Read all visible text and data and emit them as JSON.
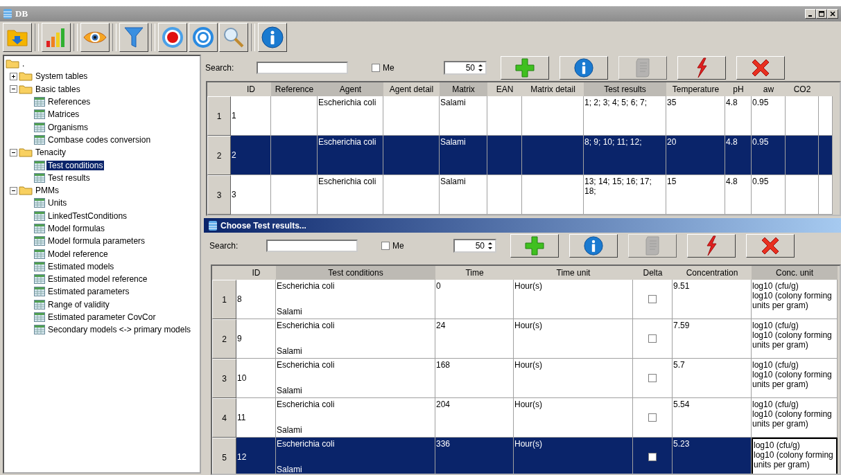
{
  "window": {
    "title": "DB"
  },
  "toolbar": [
    {
      "kind": "folder"
    },
    {
      "kind": "chart"
    },
    {
      "kind": "eye"
    },
    {
      "kind": "filter"
    },
    {
      "kind": "record"
    },
    {
      "kind": "ring"
    },
    {
      "kind": "search"
    },
    {
      "kind": "info"
    }
  ],
  "tree": {
    "label": ".",
    "children": [
      {
        "label": "System tables",
        "kind": "folder",
        "expanded": false,
        "selected": false
      },
      {
        "label": "Basic tables",
        "kind": "folder",
        "expanded": true,
        "selected": false,
        "children": [
          {
            "label": "References",
            "kind": "table",
            "selected": false
          },
          {
            "label": "Matrices",
            "kind": "table",
            "selected": false
          },
          {
            "label": "Organisms",
            "kind": "table",
            "selected": false
          },
          {
            "label": "Combase codes conversion",
            "kind": "table",
            "selected": false
          }
        ]
      },
      {
        "label": "Tenacity",
        "kind": "folder",
        "expanded": true,
        "selected": false,
        "children": [
          {
            "label": "Test conditions",
            "kind": "table",
            "selected": true
          },
          {
            "label": "Test results",
            "kind": "table",
            "selected": false
          }
        ]
      },
      {
        "label": "PMMs",
        "kind": "folder",
        "expanded": true,
        "selected": false,
        "children": [
          {
            "label": "Units",
            "kind": "table",
            "selected": false
          },
          {
            "label": "LinkedTestConditions",
            "kind": "table",
            "selected": false
          },
          {
            "label": "Model formulas",
            "kind": "table",
            "selected": false
          },
          {
            "label": "Model formula parameters",
            "kind": "table",
            "selected": false
          },
          {
            "label": "Model reference",
            "kind": "table",
            "selected": false
          },
          {
            "label": "Estimated models",
            "kind": "table",
            "selected": false
          },
          {
            "label": "Estimated model reference",
            "kind": "table",
            "selected": false
          },
          {
            "label": "Estimated parameters",
            "kind": "table",
            "selected": false
          },
          {
            "label": "Range of validity",
            "kind": "table",
            "selected": false
          },
          {
            "label": "Estimated parameter CovCor",
            "kind": "table",
            "selected": false
          },
          {
            "label": "Secondary models <-> primary models",
            "kind": "table",
            "selected": false
          }
        ]
      }
    ]
  },
  "main": {
    "search_label": "Search:",
    "me": {
      "label": "Me",
      "checked": false
    },
    "page_size": "50",
    "actions": [
      {
        "kind": "add",
        "disabled": false
      },
      {
        "kind": "info",
        "disabled": false
      },
      {
        "kind": "script",
        "disabled": true
      },
      {
        "kind": "lightning",
        "disabled": false
      },
      {
        "kind": "delete",
        "disabled": false
      }
    ],
    "table": {
      "columns": [
        {
          "label": "ID",
          "shaded": false
        },
        {
          "label": "Reference",
          "shaded": true
        },
        {
          "label": "Agent",
          "shaded": true
        },
        {
          "label": "Agent detail",
          "shaded": false
        },
        {
          "label": "Matrix",
          "shaded": true
        },
        {
          "label": "EAN",
          "shaded": false
        },
        {
          "label": "Matrix detail",
          "shaded": false
        },
        {
          "label": "Test results",
          "shaded": true
        },
        {
          "label": "Temperature",
          "shaded": false
        },
        {
          "label": "pH",
          "shaded": false
        },
        {
          "label": "aw",
          "shaded": false
        },
        {
          "label": "CO2",
          "shaded": false
        }
      ],
      "rows": [
        {
          "number": "1",
          "selected": false,
          "cells": [
            "1",
            null,
            "Escherichia coli",
            null,
            "Salami",
            null,
            null,
            "1; 2; 3; 4; 5; 6; 7;",
            "35",
            "4.8",
            "0.95",
            null
          ]
        },
        {
          "number": "2",
          "selected": true,
          "cells": [
            "2",
            null,
            "Escherichia coli",
            null,
            "Salami",
            null,
            null,
            "8; 9; 10; 11; 12;",
            "20",
            "4.8",
            "0.95",
            null
          ]
        },
        {
          "number": "3",
          "selected": false,
          "cells": [
            "3",
            null,
            "Escherichia coli",
            null,
            "Salami",
            null,
            null,
            "13; 14; 15; 16; 17; 18;",
            "15",
            "4.8",
            "0.95",
            null
          ]
        }
      ]
    }
  },
  "dialog": {
    "title": "Choose Test results...",
    "search_label": "Search:",
    "me": {
      "label": "Me",
      "checked": false
    },
    "page_size": "50",
    "actions": [
      {
        "kind": "add",
        "disabled": false
      },
      {
        "kind": "info",
        "disabled": false
      },
      {
        "kind": "script",
        "disabled": true
      },
      {
        "kind": "lightning",
        "disabled": false
      },
      {
        "kind": "delete",
        "disabled": false
      }
    ],
    "table": {
      "columns": [
        {
          "label": "ID",
          "shaded": false
        },
        {
          "label": "Test conditions",
          "shaded": true
        },
        {
          "label": "Time",
          "shaded": false
        },
        {
          "label": "Time unit",
          "shaded": false
        },
        {
          "label": "Delta",
          "shaded": false
        },
        {
          "label": "Concentration",
          "shaded": false
        },
        {
          "label": "Conc. unit",
          "shaded": true
        }
      ],
      "rows": [
        {
          "number": "1",
          "selected": false,
          "id": "8",
          "test_conditions": [
            "Escherichia coli",
            "Salami"
          ],
          "time": "0",
          "time_unit": "Hour(s)",
          "delta": false,
          "concentration": "9.51",
          "conc_unit": [
            "log10 (cfu/g)",
            "log10 (colony forming units per gram)"
          ],
          "conc_unit_focused": false
        },
        {
          "number": "2",
          "selected": false,
          "id": "9",
          "test_conditions": [
            "Escherichia coli",
            "Salami"
          ],
          "time": "24",
          "time_unit": "Hour(s)",
          "delta": false,
          "concentration": "7.59",
          "conc_unit": [
            "log10 (cfu/g)",
            "log10 (colony forming units per gram)"
          ],
          "conc_unit_focused": false
        },
        {
          "number": "3",
          "selected": false,
          "id": "10",
          "test_conditions": [
            "Escherichia coli",
            "Salami"
          ],
          "time": "168",
          "time_unit": "Hour(s)",
          "delta": false,
          "concentration": "5.7",
          "conc_unit": [
            "log10 (cfu/g)",
            "log10 (colony forming units per gram)"
          ],
          "conc_unit_focused": false
        },
        {
          "number": "4",
          "selected": false,
          "id": "11",
          "test_conditions": [
            "Escherichia coli",
            "Salami"
          ],
          "time": "204",
          "time_unit": "Hour(s)",
          "delta": false,
          "concentration": "5.54",
          "conc_unit": [
            "log10 (cfu/g)",
            "log10 (colony forming units per gram)"
          ],
          "conc_unit_focused": false
        },
        {
          "number": "5",
          "selected": true,
          "id": "12",
          "test_conditions": [
            "Escherichia coli",
            "Salami"
          ],
          "time": "336",
          "time_unit": "Hour(s)",
          "delta": false,
          "concentration": "5.23",
          "conc_unit": [
            "log10 (cfu/g)",
            "log10 (colony forming units per gram)"
          ],
          "conc_unit_focused": true
        }
      ]
    }
  }
}
